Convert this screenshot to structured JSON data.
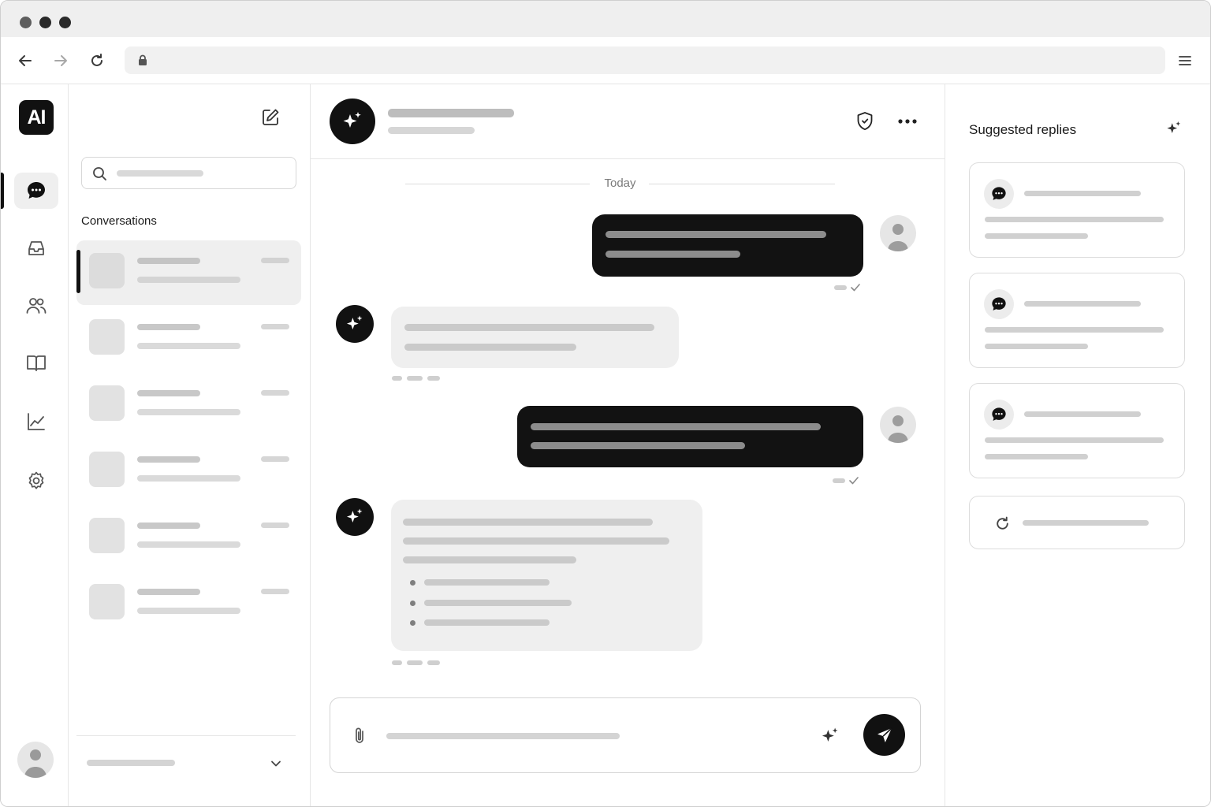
{
  "sidebar": {
    "logo_text": "AI",
    "items": [
      {
        "name": "chats",
        "icon": "chat-bubble-icon",
        "active": true
      },
      {
        "name": "inbox",
        "icon": "inbox-tray-icon",
        "active": false
      },
      {
        "name": "contacts",
        "icon": "users-icon",
        "active": false
      },
      {
        "name": "knowledge",
        "icon": "book-icon",
        "active": false
      },
      {
        "name": "analytics",
        "icon": "line-chart-icon",
        "active": false
      },
      {
        "name": "settings",
        "icon": "gear-icon",
        "active": false
      }
    ]
  },
  "conversations": {
    "section_title": "Conversations",
    "count_shown": 6,
    "active_index": 0
  },
  "chat": {
    "day_separator": "Today",
    "message_order": [
      "user",
      "assistant",
      "user",
      "assistant"
    ]
  },
  "suggestions": {
    "title": "Suggested replies",
    "cards_shown": 3
  },
  "colors": {
    "accent": "#111111",
    "surface_muted": "#efefef",
    "placeholder": "#cfcfcf"
  }
}
